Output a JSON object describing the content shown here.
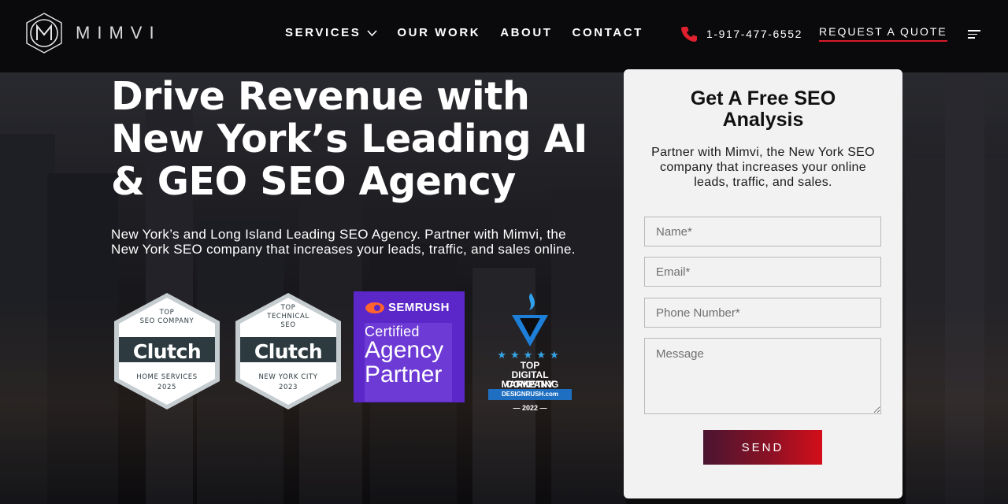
{
  "header": {
    "logo_text": "MIMVI",
    "nav": [
      {
        "label": "SERVICES",
        "has_dropdown": true
      },
      {
        "label": "OUR WORK"
      },
      {
        "label": "ABOUT"
      },
      {
        "label": "CONTACT"
      }
    ],
    "phone": "1-917-477-6552",
    "cta": "REQUEST A QUOTE",
    "icons": [
      "logo-m-icon",
      "chevron-down-icon",
      "phone-icon",
      "menu-icon"
    ]
  },
  "hero": {
    "title_line1": "Drive Revenue with",
    "title_line2": "New York’s Leading AI",
    "title_line3": "& GEO SEO Agency",
    "subtitle_line1": "New York’s and Long Island Leading SEO Agency. Partner with Mimvi, the",
    "subtitle_line2": "New York SEO company that increases your leads, traffic, and sales online."
  },
  "badges": {
    "clutch1": {
      "top_line1": "TOP",
      "top_line2": "SEO COMPANY",
      "brand": "Clutch",
      "bottom": "HOME SERVICES",
      "year": "2025"
    },
    "clutch2": {
      "top_line1": "TOP",
      "top_line2": "TECHNICAL",
      "top_line3": "SEO",
      "brand": "Clutch",
      "bottom": "NEW YORK CITY",
      "year": "2023"
    },
    "semrush": {
      "brand": "SEMRUSH",
      "line1": "Certified",
      "line2": "Agency",
      "line3": "Partner"
    },
    "designrush": {
      "stars": "★★★★★",
      "line1": "TOP",
      "line2": "DIGITAL MARKETING",
      "line3": "COMPANY",
      "ribbon": "DESIGNRUSH.com",
      "year": "— 2022 —"
    }
  },
  "form": {
    "title_line1": "Get A Free SEO",
    "title_line2": "Analysis",
    "description": "Partner with Mimvi, the New York SEO company that increases your online leads, traffic, and sales.",
    "name_placeholder": "Name*",
    "email_placeholder": "Email*",
    "phone_placeholder": "Phone Number*",
    "message_placeholder": "Message",
    "submit": "SEND"
  },
  "colors": {
    "header_bg": "#0a0a0c",
    "accent_red": "#d7192c",
    "semrush_purple": "#5b27c9",
    "card_bg": "#f2f2f2",
    "clutch_dark": "#2d3b40"
  }
}
